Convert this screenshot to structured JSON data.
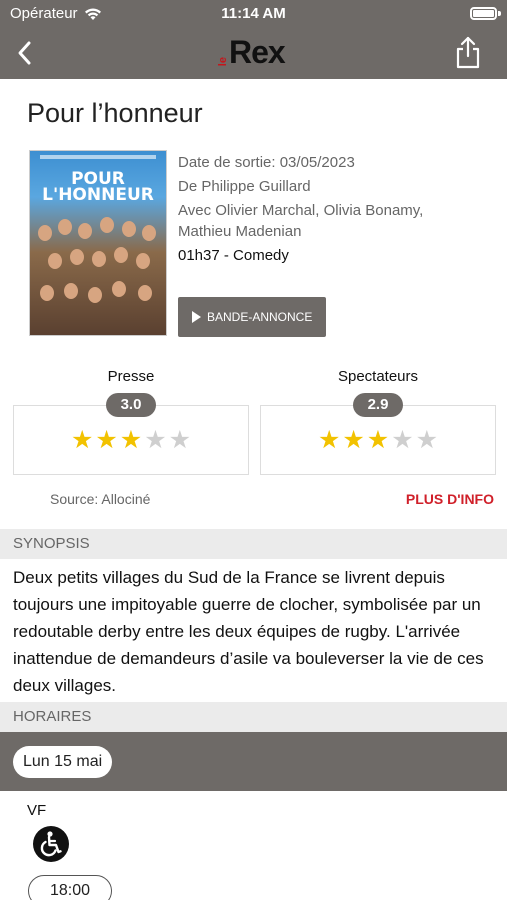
{
  "status_bar": {
    "carrier": "Opérateur",
    "time": "11:14 AM",
    "wifi_icon": "wifi-icon",
    "battery_icon": "battery-icon"
  },
  "nav": {
    "back_icon": "chevron-left-icon",
    "share_icon": "share-icon",
    "logo_small": "le",
    "logo_text": "Rex"
  },
  "movie": {
    "title": "Pour l’honneur",
    "poster_title": "POUR L'HONNEUR",
    "release": "Date de sortie: 03/05/2023",
    "director": "De Philippe Guillard",
    "cast": "Avec Olivier Marchal, Olivia Bonamy, Mathieu Madenian",
    "duration_genre": "01h37 - Comedy",
    "trailer_label": "BANDE-ANNONCE"
  },
  "ratings": {
    "press": {
      "label": "Presse",
      "score": "3.0",
      "stars_filled": 3,
      "stars_total": 5
    },
    "audience": {
      "label": "Spectateurs",
      "score": "2.9",
      "stars_filled": 3,
      "stars_total": 5
    },
    "source": "Source: Allociné",
    "more_info": "PLUS D'INFO",
    "colors": {
      "star_full": "#f2c200",
      "star_empty": "#cfcfcf",
      "accent": "#d0202a"
    }
  },
  "synopsis": {
    "header": "SYNOPSIS",
    "text": "Deux petits villages du Sud de la France se livrent depuis toujours une impitoyable guerre de clocher, symbolisée par un redoutable derby entre les deux équipes de rugby. L'arrivée inattendue de demandeurs d’asile va bouleverser la vie de ces deux villages."
  },
  "schedule": {
    "header": "HORAIRES",
    "selected_date": "Lun 15 mai",
    "version": "VF",
    "accessibility_icon": "wheelchair-icon",
    "showtimes": [
      "18:00"
    ]
  }
}
